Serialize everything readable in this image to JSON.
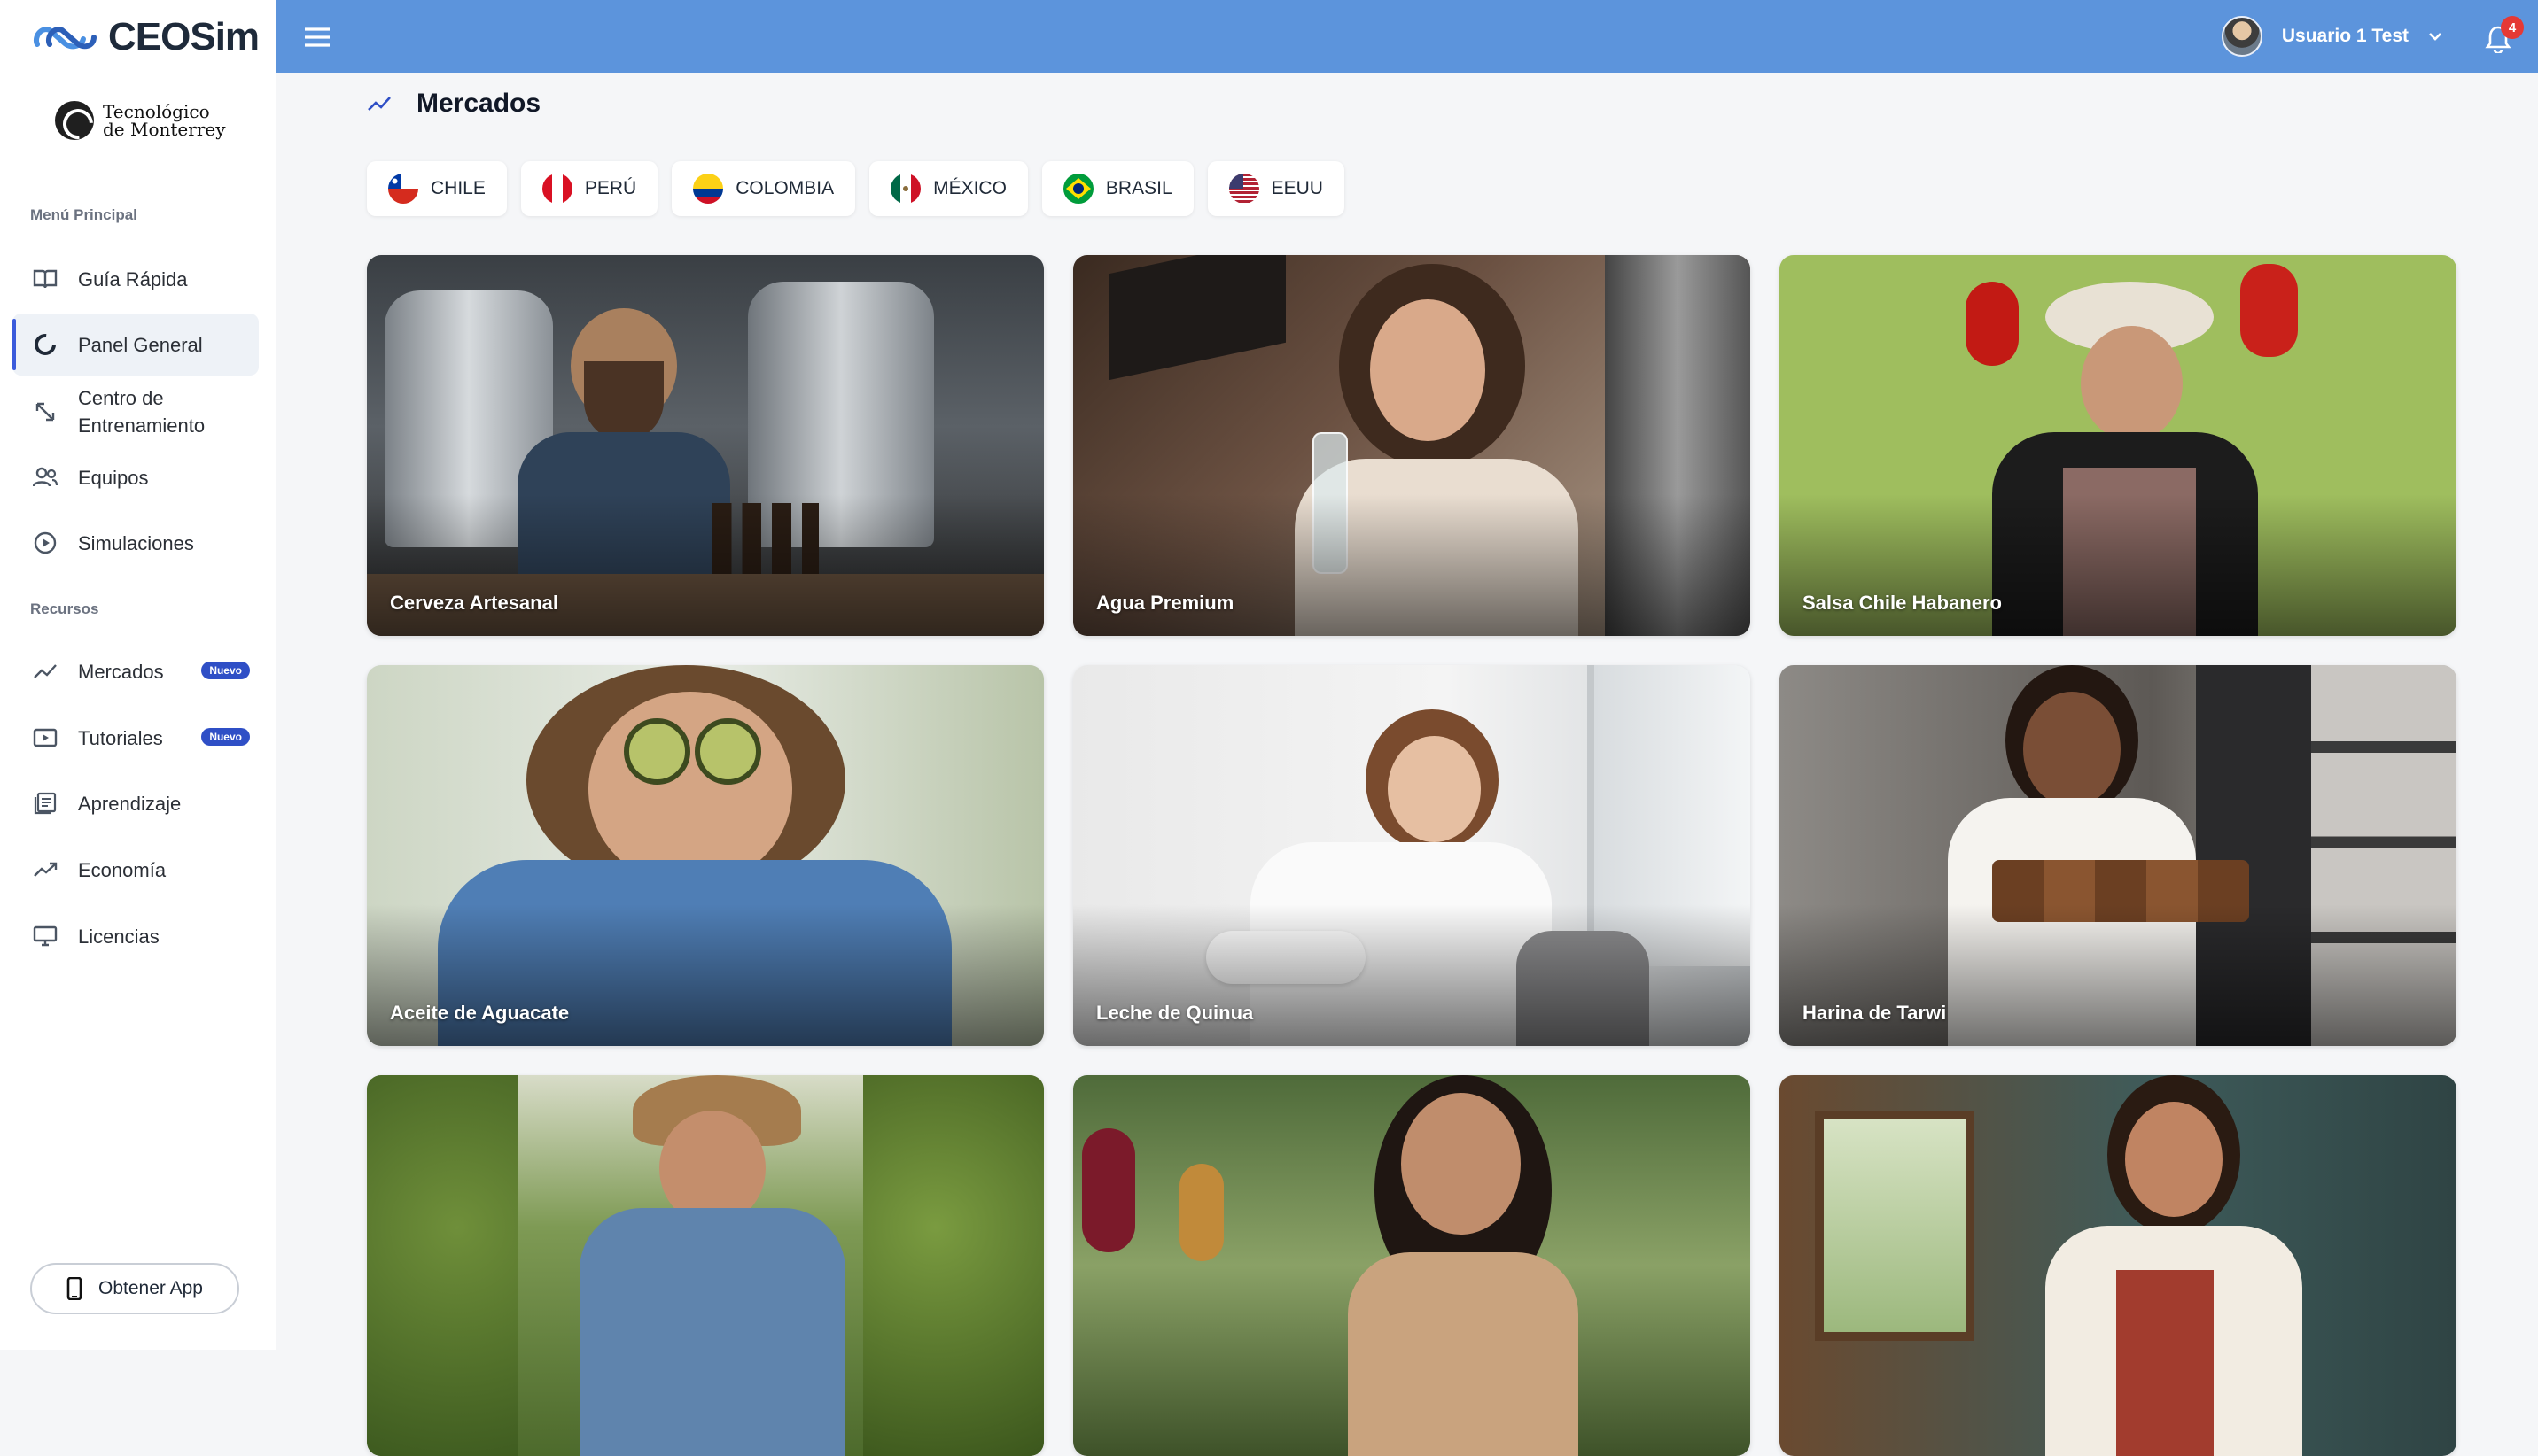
{
  "brand": {
    "name": "CEOSim",
    "partner": "Tecnológico de Monterrey",
    "partner_line1": "Tecnológico",
    "partner_line2": "de Monterrey"
  },
  "sidebar": {
    "main_section": "Menú Principal",
    "main_items": [
      {
        "label": "Guía Rápida",
        "icon": "book-icon"
      },
      {
        "label": "Panel General",
        "icon": "dashboard-ring-icon",
        "active": true
      },
      {
        "label_line1": "Centro de",
        "label_line2": "Entrenamiento",
        "icon": "expand-arrows-icon"
      },
      {
        "label": "Equipos",
        "icon": "team-icon"
      },
      {
        "label": "Simulaciones",
        "icon": "play-circle-icon"
      }
    ],
    "resources_section": "Recursos",
    "resource_items": [
      {
        "label": "Mercados",
        "icon": "trend-icon",
        "badge": "Nuevo"
      },
      {
        "label": "Tutoriales",
        "icon": "video-icon",
        "badge": "Nuevo"
      },
      {
        "label": "Aprendizaje",
        "icon": "notebook-icon"
      },
      {
        "label": "Economía",
        "icon": "trending-up-icon"
      },
      {
        "label": "Licencias",
        "icon": "monitor-icon"
      }
    ],
    "get_app": "Obtener App"
  },
  "topbar": {
    "user_name": "Usuario 1 Test",
    "notification_count": "4",
    "accent": "#5c94dc"
  },
  "page": {
    "title": "Mercados"
  },
  "countries": [
    {
      "label": "CHILE",
      "flag": "chile"
    },
    {
      "label": "PERÚ",
      "flag": "peru"
    },
    {
      "label": "COLOMBIA",
      "flag": "colombia"
    },
    {
      "label": "MÉXICO",
      "flag": "mexico"
    },
    {
      "label": "BRASIL",
      "flag": "brasil"
    },
    {
      "label": "EEUU",
      "flag": "usa"
    }
  ],
  "products": [
    {
      "title": "Cerveza Artesanal"
    },
    {
      "title": "Agua Premium"
    },
    {
      "title": "Salsa Chile Habanero"
    },
    {
      "title": "Aceite de Aguacate"
    },
    {
      "title": "Leche de Quinua"
    },
    {
      "title": "Harina de Tarwi"
    },
    {
      "title": ""
    },
    {
      "title": ""
    },
    {
      "title": ""
    }
  ]
}
